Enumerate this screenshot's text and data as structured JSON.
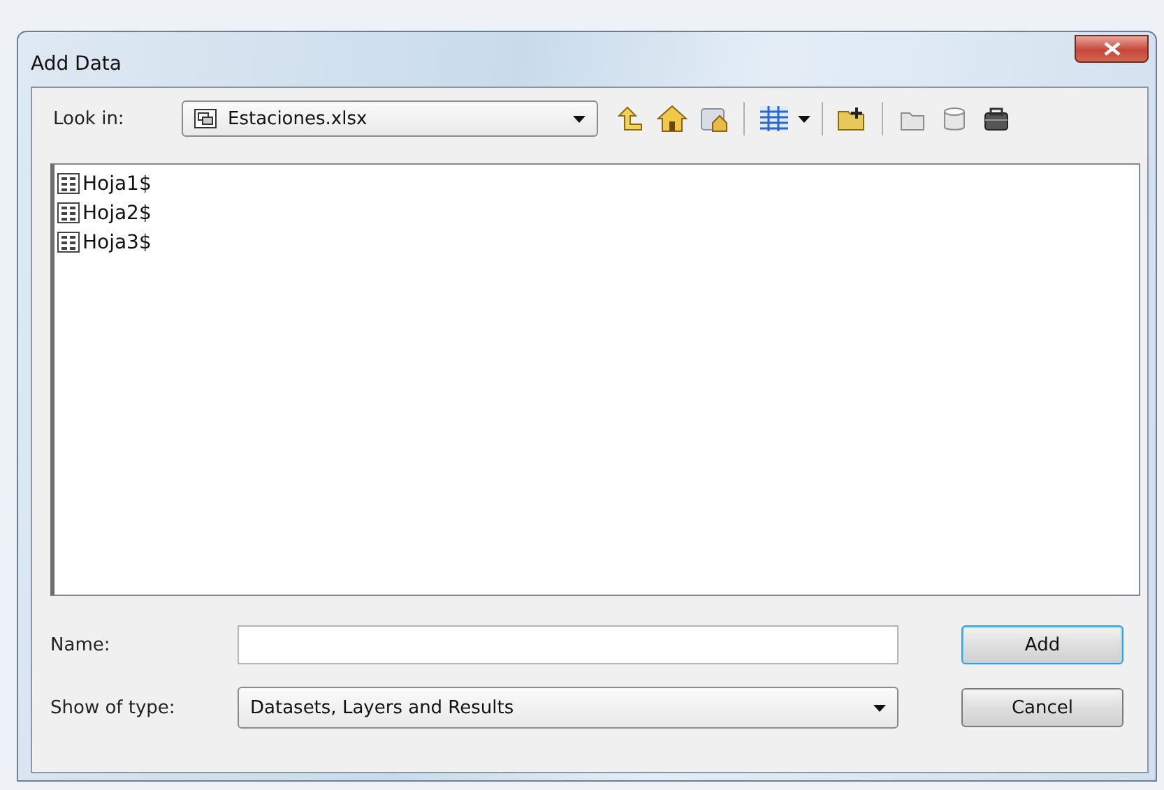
{
  "window": {
    "title": "Add Data"
  },
  "look_in": {
    "label": "Look in:",
    "value": "Estaciones.xlsx"
  },
  "items": [
    {
      "name": "Hoja1$",
      "selected": false
    },
    {
      "name": "Hoja2$",
      "selected": false
    },
    {
      "name": "Hoja3$",
      "selected": false
    }
  ],
  "name_field": {
    "label": "Name:"
  },
  "type_field": {
    "label": "Show of type:",
    "value": "Datasets, Layers and Results"
  },
  "buttons": [
    {
      "label": "Add",
      "kind": "default"
    },
    {
      "label": "Cancel",
      "kind": "normal"
    }
  ]
}
